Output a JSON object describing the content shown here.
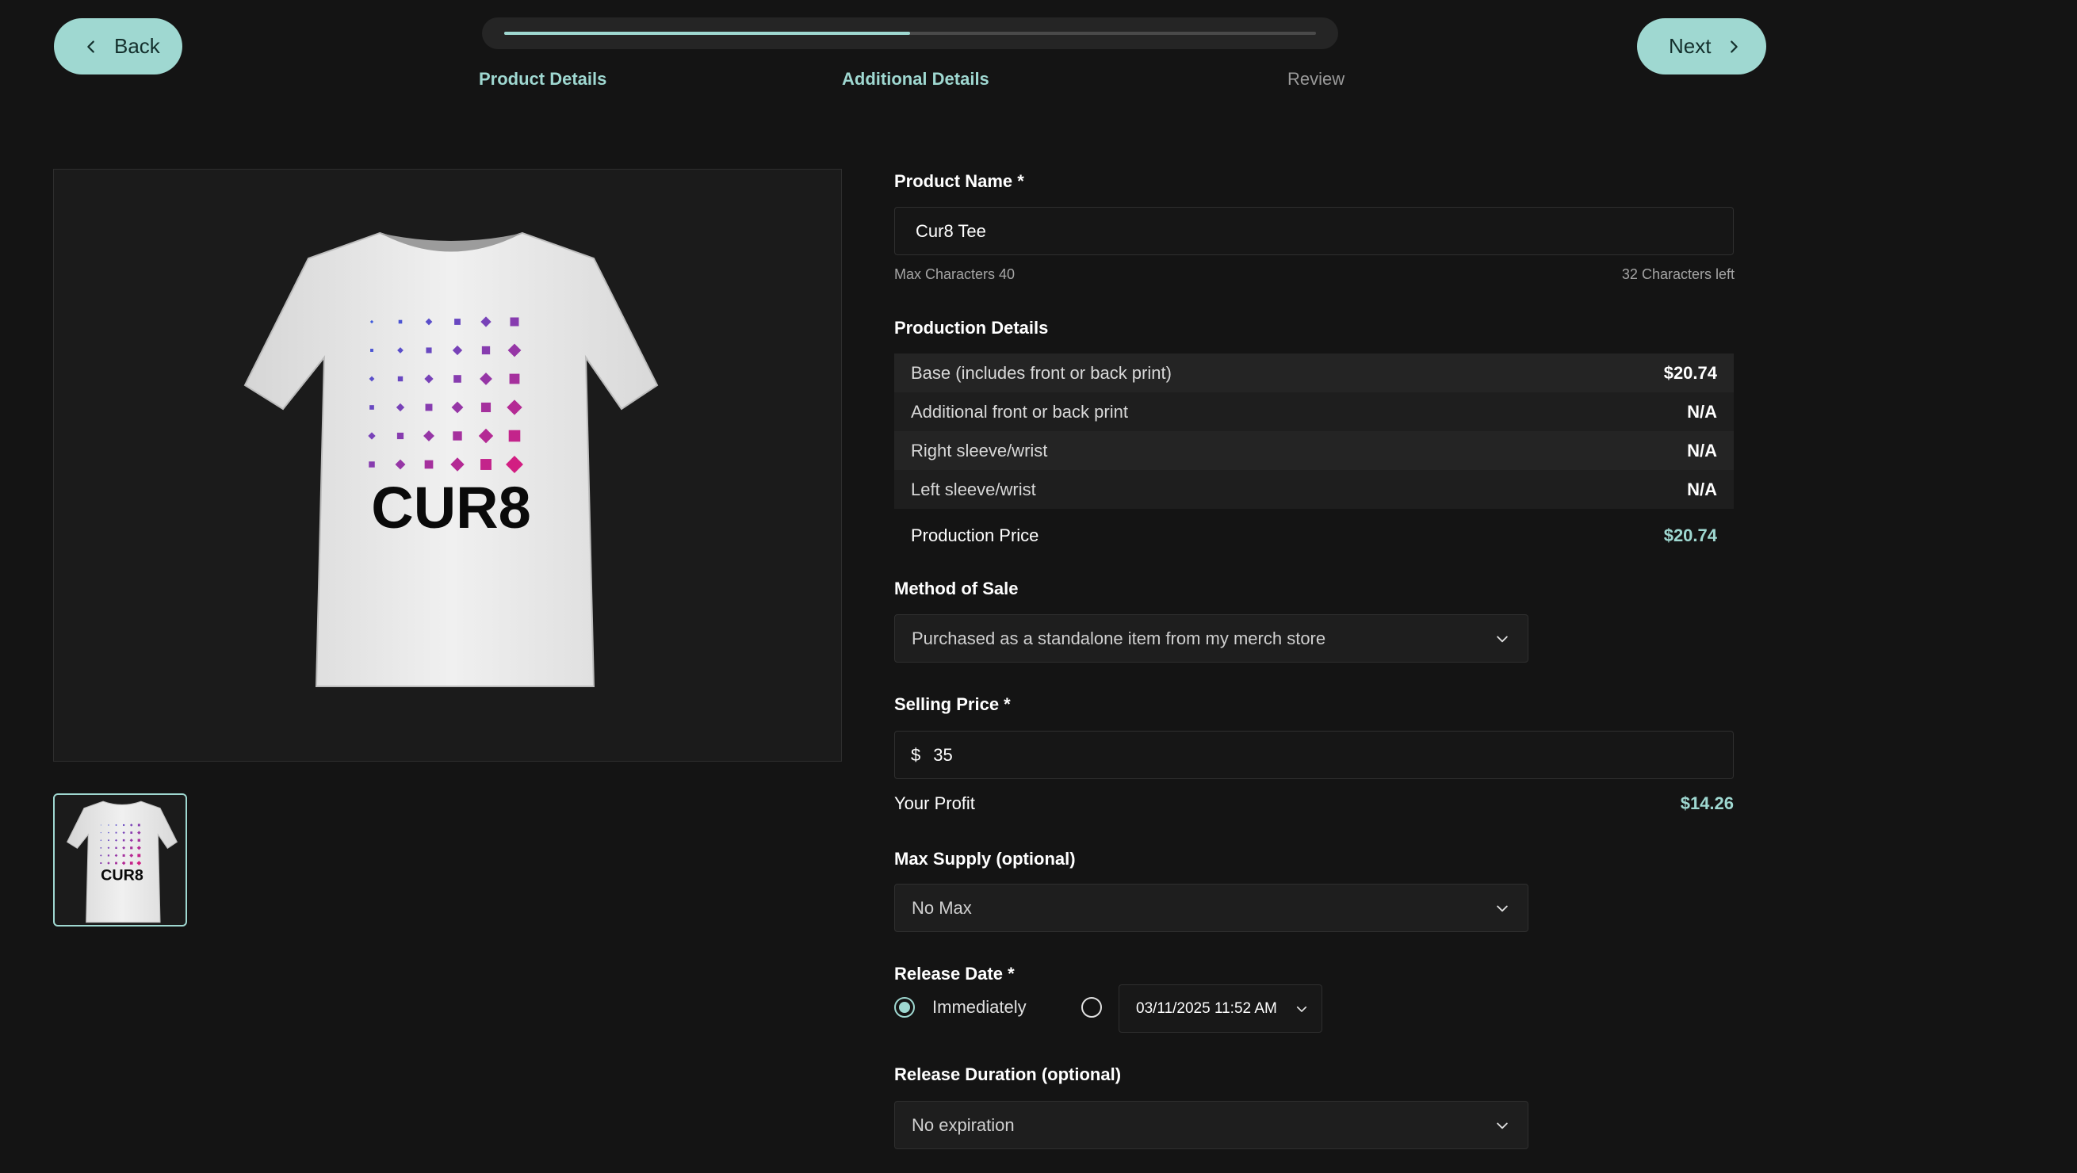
{
  "nav": {
    "back_label": "Back",
    "next_label": "Next",
    "progress_fraction": 0.5,
    "steps": [
      "Product Details",
      "Additional Details",
      "Review"
    ],
    "accent_color": "#9fd8d1"
  },
  "preview": {
    "brand_text": "CUR8"
  },
  "form": {
    "product_name": {
      "label": "Product Name *",
      "value": "Cur8 Tee",
      "max_hint": "Max Characters 40",
      "left_hint": "32 Characters left"
    },
    "production": {
      "label": "Production Details",
      "rows": [
        {
          "name": "Base (includes front or back print)",
          "value": "$20.74"
        },
        {
          "name": "Additional front or back print",
          "value": "N/A"
        },
        {
          "name": "Right sleeve/wrist",
          "value": "N/A"
        },
        {
          "name": "Left sleeve/wrist",
          "value": "N/A"
        }
      ],
      "total_label": "Production Price",
      "total_value": "$20.74"
    },
    "method_of_sale": {
      "label": "Method of Sale",
      "value": "Purchased as a standalone item from my merch store"
    },
    "selling_price": {
      "label": "Selling Price *",
      "currency": "$",
      "value": "35"
    },
    "profit": {
      "label": "Your Profit",
      "value": "$14.26"
    },
    "max_supply": {
      "label": "Max Supply (optional)",
      "value": "No Max"
    },
    "release_date": {
      "label": "Release Date *",
      "immediately_label": "Immediately",
      "date_value": "03/11/2025 11:52 AM"
    },
    "release_duration": {
      "label": "Release Duration (optional)",
      "value": "No expiration"
    }
  }
}
